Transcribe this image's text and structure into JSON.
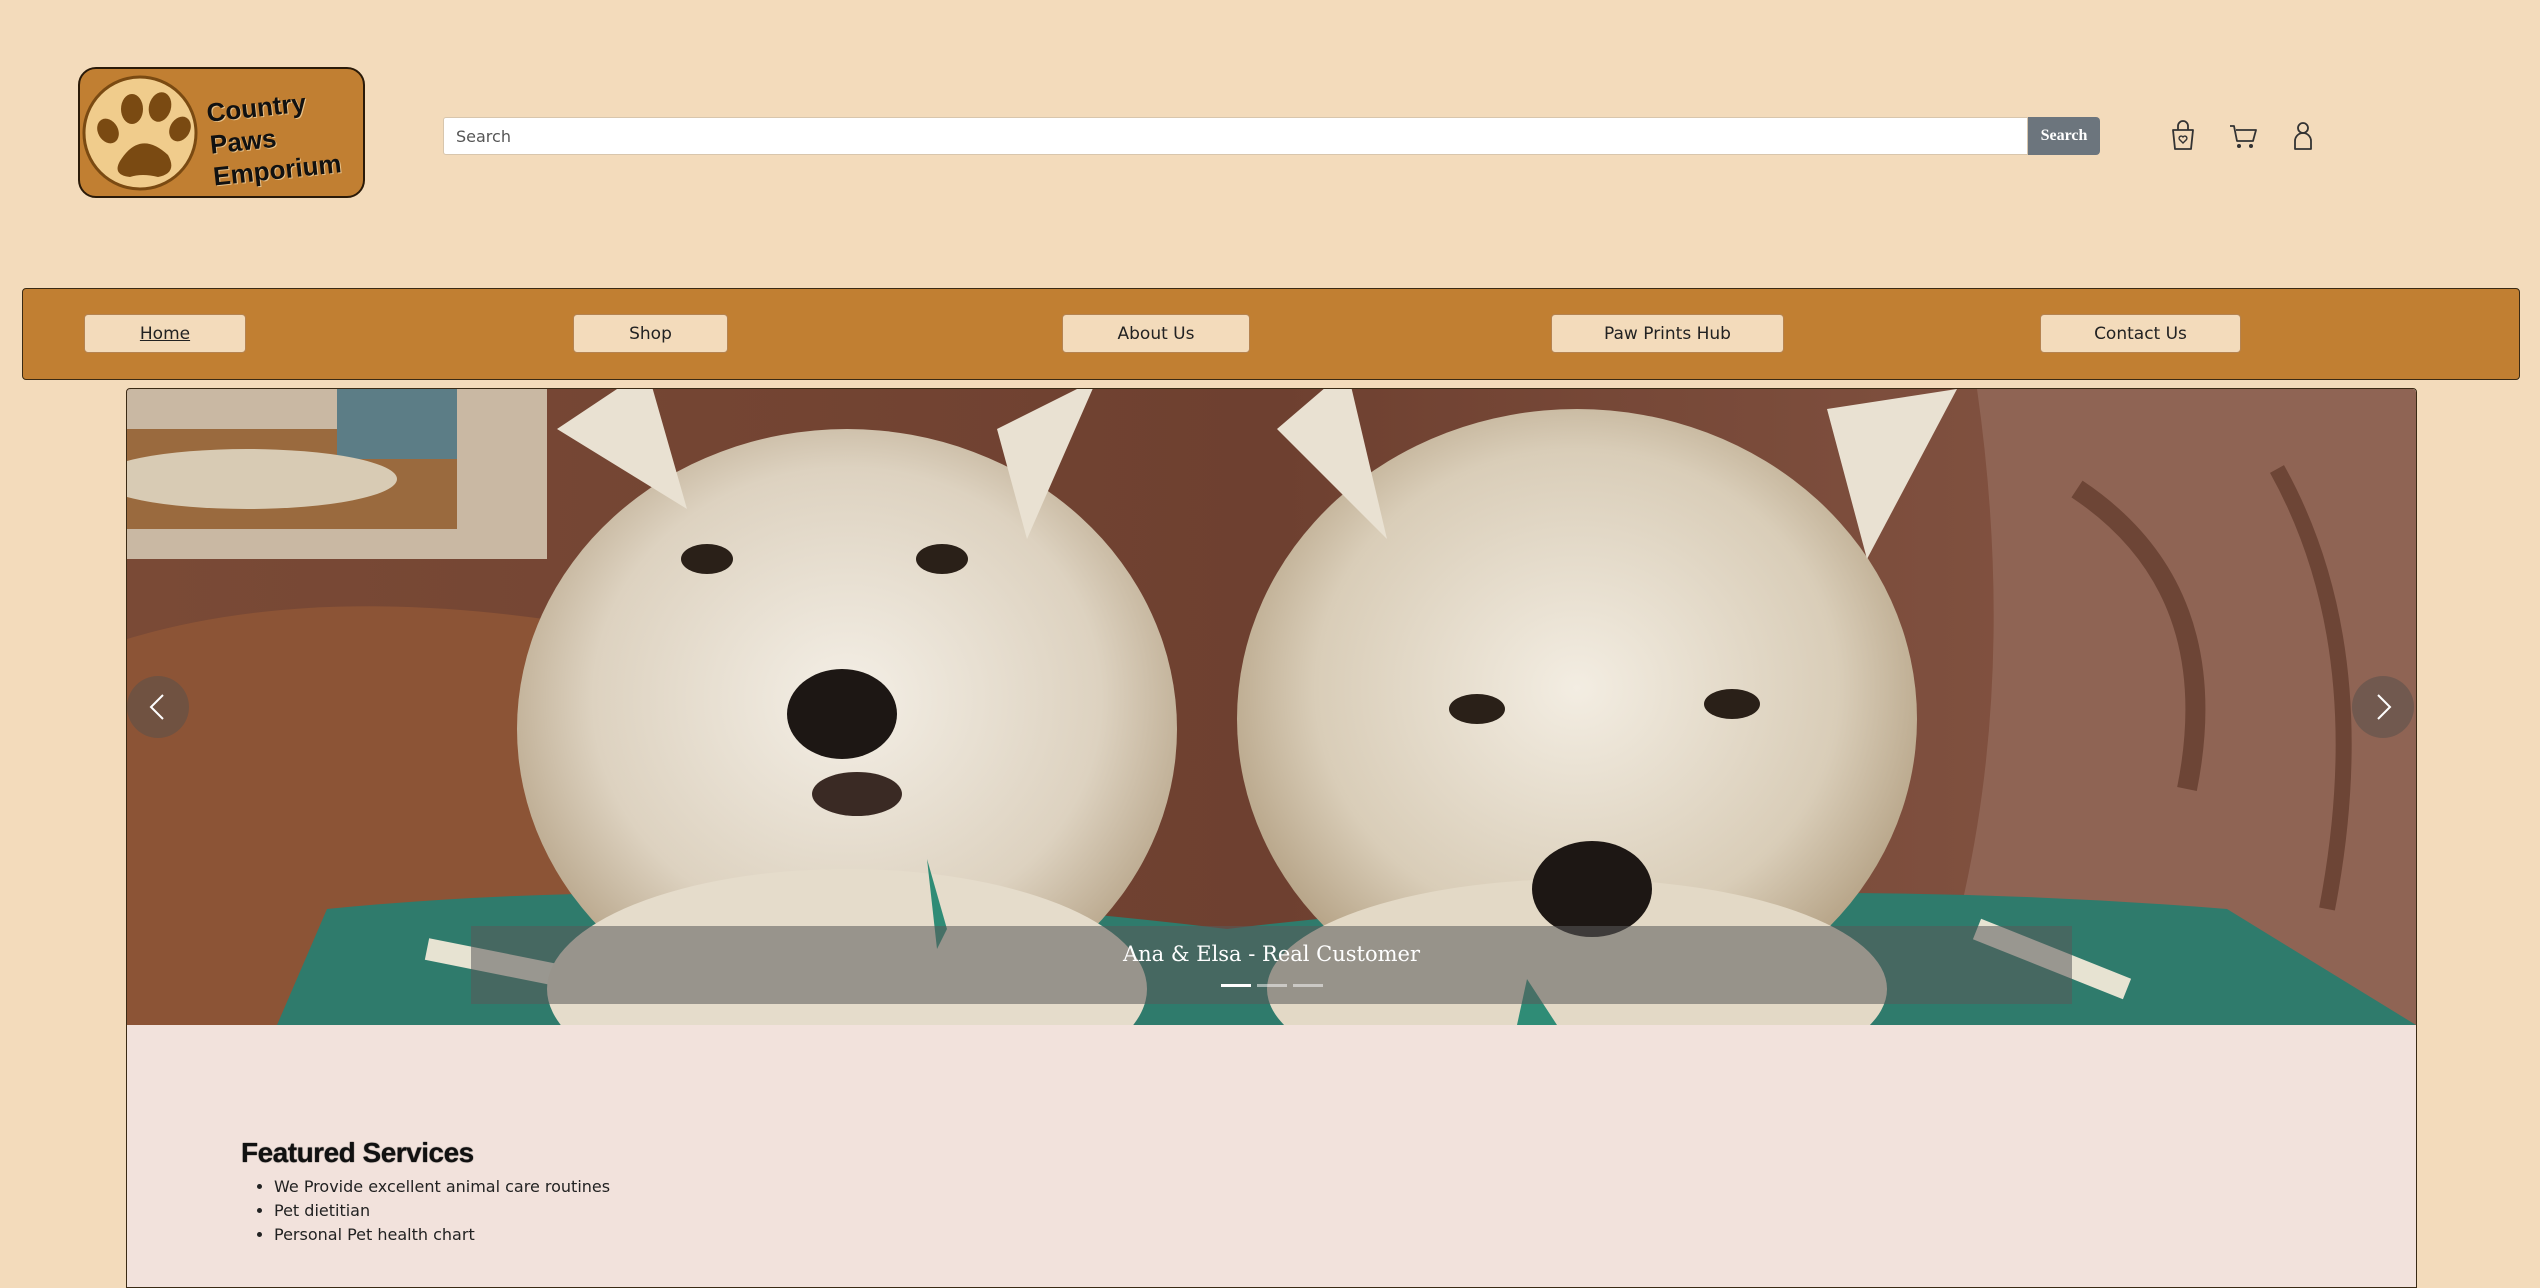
{
  "header": {
    "logo_line1": "Country Paws",
    "logo_line2": "Emporium",
    "search_placeholder": "Search",
    "search_button": "Search",
    "icons": [
      "shopping-bag-icon",
      "cart-icon",
      "user-icon"
    ]
  },
  "nav": {
    "items": [
      {
        "label": "Home",
        "active": true
      },
      {
        "label": "Shop"
      },
      {
        "label": "About Us"
      },
      {
        "label": "Paw Prints Hub"
      },
      {
        "label": "Contact Us"
      }
    ]
  },
  "carousel": {
    "caption": "Ana & Elsa - Real Customer",
    "slide_count": 3,
    "active_slide": 1,
    "prev_icon": "chevron-left-icon",
    "next_icon": "chevron-right-icon"
  },
  "featured": {
    "title": "Featured Services",
    "items": [
      "We Provide excellent animal care routines",
      "Pet dietitian",
      "Personal Pet health chart"
    ]
  },
  "colors": {
    "background": "#f3dbbb",
    "nav_bar": "#c17f32",
    "search_button": "#6c757d",
    "content_bg": "#f2e2dc"
  }
}
